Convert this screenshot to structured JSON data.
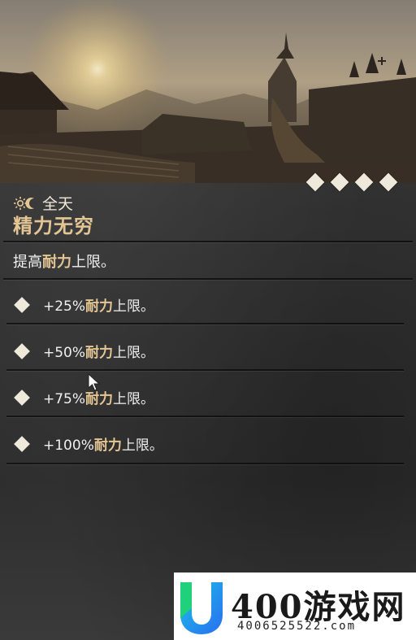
{
  "rarity": {
    "level": 4,
    "max": 4
  },
  "skill": {
    "time_icon": "sun-moon-icon",
    "time_of_day": "全天",
    "name": "精力无穷",
    "description": {
      "prefix": "提高",
      "keyword": "耐力",
      "suffix": "上限。"
    }
  },
  "tiers": [
    {
      "value": "+25%",
      "keyword": "耐力",
      "suffix": "上限。"
    },
    {
      "value": "+50%",
      "keyword": "耐力",
      "suffix": "上限。"
    },
    {
      "value": "+75%",
      "keyword": "耐力",
      "suffix": "上限。"
    },
    {
      "value": "+100%",
      "keyword": "耐力",
      "suffix": "上限。"
    }
  ],
  "watermark": {
    "brand": "400游戏网",
    "site": "4006525522.com"
  },
  "colors": {
    "highlight": "#e4c694",
    "diamond": "#efe9dc",
    "panel": "#333333"
  }
}
